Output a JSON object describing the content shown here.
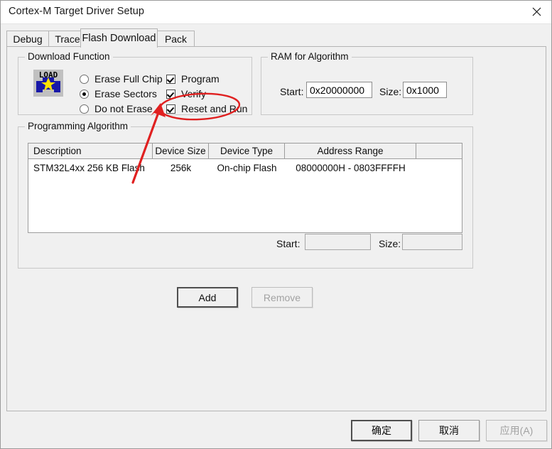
{
  "window": {
    "title": "Cortex-M Target Driver Setup",
    "close_icon": "close-icon"
  },
  "tabs": [
    {
      "label": "Debug",
      "selected": false
    },
    {
      "label": "Trace",
      "selected": false
    },
    {
      "label": "Flash Download",
      "selected": true
    },
    {
      "label": "Pack",
      "selected": false
    }
  ],
  "download_function": {
    "caption": "Download Function",
    "icon_label": "LOAD",
    "radios": [
      {
        "label": "Erase Full Chip",
        "checked": false
      },
      {
        "label": "Erase Sectors",
        "checked": true
      },
      {
        "label": "Do not Erase",
        "checked": false
      }
    ],
    "checkboxes": [
      {
        "label": "Program",
        "checked": true
      },
      {
        "label": "Verify",
        "checked": true
      },
      {
        "label": "Reset and Run",
        "checked": true
      }
    ]
  },
  "ram_for_algorithm": {
    "caption": "RAM for Algorithm",
    "start_label": "Start:",
    "start_value": "0x20000000",
    "size_label": "Size:",
    "size_value": "0x1000"
  },
  "programming_algorithm": {
    "caption": "Programming Algorithm",
    "columns": [
      "Description",
      "Device Size",
      "Device Type",
      "Address Range",
      ""
    ],
    "rows": [
      {
        "description": "STM32L4xx 256 KB Flash",
        "device_size": "256k",
        "device_type": "On-chip Flash",
        "address_range": "08000000H - 0803FFFFH",
        "extra": ""
      }
    ],
    "start_label": "Start:",
    "start_value": "",
    "size_label": "Size:",
    "size_value": "",
    "add_label": "Add",
    "remove_label": "Remove"
  },
  "dialog_buttons": {
    "ok": "确定",
    "cancel": "取消",
    "apply": "应用(A)"
  },
  "annotation": {
    "color": "#e02020",
    "shapes": [
      "ellipse-highlight",
      "arrow-pointer"
    ],
    "target": "Reset and Run"
  }
}
